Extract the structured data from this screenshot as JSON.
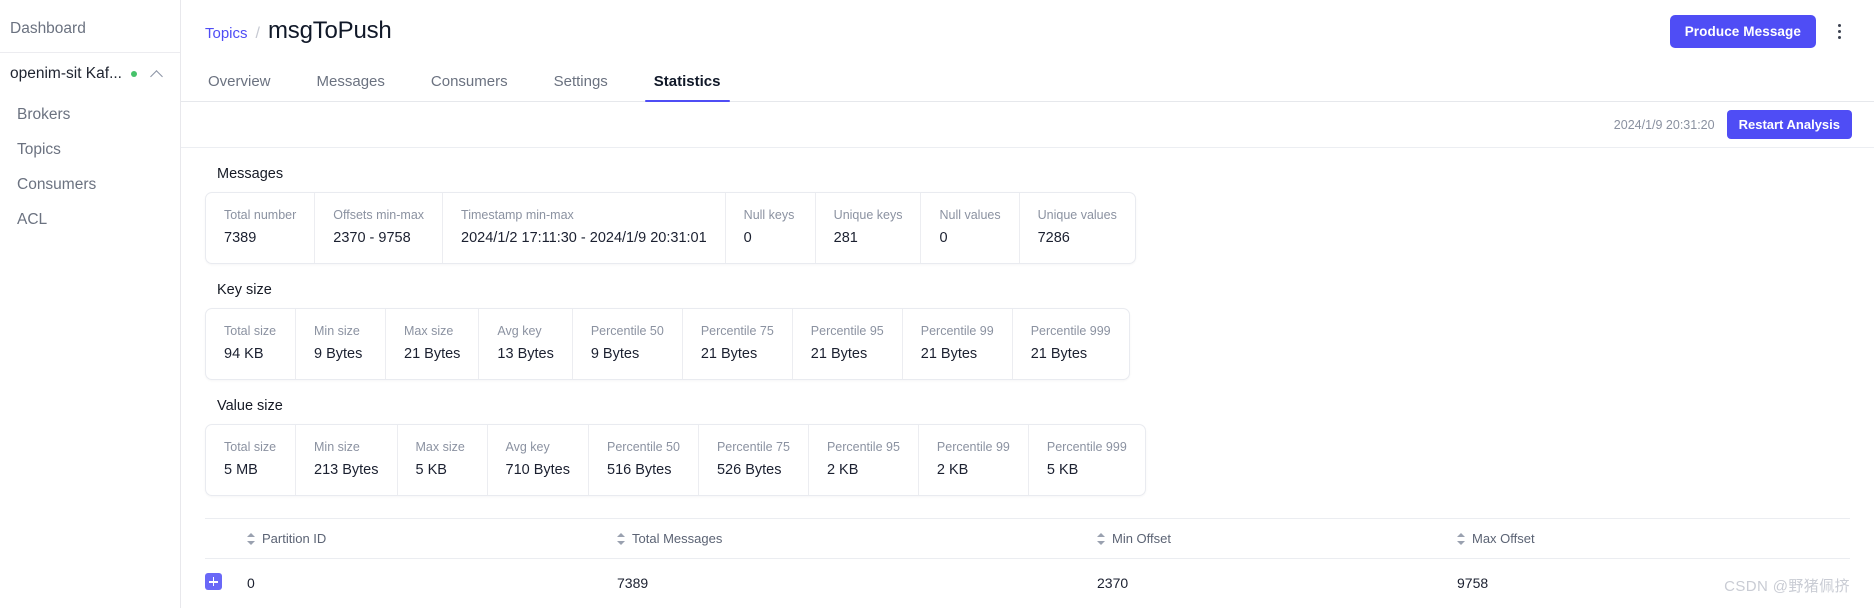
{
  "sidebar": {
    "dashboard_label": "Dashboard",
    "cluster": {
      "name": "openim-sit Kaf...",
      "status_color": "#46c26a"
    },
    "items": [
      {
        "label": "Brokers"
      },
      {
        "label": "Topics"
      },
      {
        "label": "Consumers"
      },
      {
        "label": "ACL"
      }
    ]
  },
  "header": {
    "breadcrumb_parent": "Topics",
    "breadcrumb_separator": "/",
    "title": "msgToPush",
    "produce_button": "Produce Message",
    "accent_color": "#4f4df5"
  },
  "tabs": [
    {
      "label": "Overview",
      "active": false
    },
    {
      "label": "Messages",
      "active": false
    },
    {
      "label": "Consumers",
      "active": false
    },
    {
      "label": "Settings",
      "active": false
    },
    {
      "label": "Statistics",
      "active": true
    }
  ],
  "analysis": {
    "timestamp": "2024/1/9 20:31:20",
    "restart_button": "Restart Analysis"
  },
  "sections": [
    {
      "title": "Messages",
      "cells": [
        {
          "label": "Total number",
          "value": "7389"
        },
        {
          "label": "Offsets min-max",
          "value": "2370 - 9758"
        },
        {
          "label": "Timestamp min-max",
          "value": "2024/1/2 17:11:30 - 2024/1/9 20:31:01"
        },
        {
          "label": "Null keys",
          "value": "0"
        },
        {
          "label": "Unique keys",
          "value": "281"
        },
        {
          "label": "Null values",
          "value": "0"
        },
        {
          "label": "Unique values",
          "value": "7286"
        }
      ]
    },
    {
      "title": "Key size",
      "cells": [
        {
          "label": "Total size",
          "value": "94 KB"
        },
        {
          "label": "Min size",
          "value": "9 Bytes"
        },
        {
          "label": "Max size",
          "value": "21 Bytes"
        },
        {
          "label": "Avg key",
          "value": "13 Bytes"
        },
        {
          "label": "Percentile 50",
          "value": "9 Bytes"
        },
        {
          "label": "Percentile 75",
          "value": "21 Bytes"
        },
        {
          "label": "Percentile 95",
          "value": "21 Bytes"
        },
        {
          "label": "Percentile 99",
          "value": "21 Bytes"
        },
        {
          "label": "Percentile 999",
          "value": "21 Bytes"
        }
      ]
    },
    {
      "title": "Value size",
      "cells": [
        {
          "label": "Total size",
          "value": "5 MB"
        },
        {
          "label": "Min size",
          "value": "213 Bytes"
        },
        {
          "label": "Max size",
          "value": "5 KB"
        },
        {
          "label": "Avg key",
          "value": "710 Bytes"
        },
        {
          "label": "Percentile 50",
          "value": "516 Bytes"
        },
        {
          "label": "Percentile 75",
          "value": "526 Bytes"
        },
        {
          "label": "Percentile 95",
          "value": "2 KB"
        },
        {
          "label": "Percentile 99",
          "value": "2 KB"
        },
        {
          "label": "Percentile 999",
          "value": "5 KB"
        }
      ]
    }
  ],
  "partitions_table": {
    "columns": [
      "Partition ID",
      "Total Messages",
      "Min Offset",
      "Max Offset"
    ],
    "rows": [
      {
        "partition_id": "0",
        "total_messages": "7389",
        "min_offset": "2370",
        "max_offset": "9758"
      }
    ]
  },
  "watermark": "CSDN @野猪佩挤"
}
